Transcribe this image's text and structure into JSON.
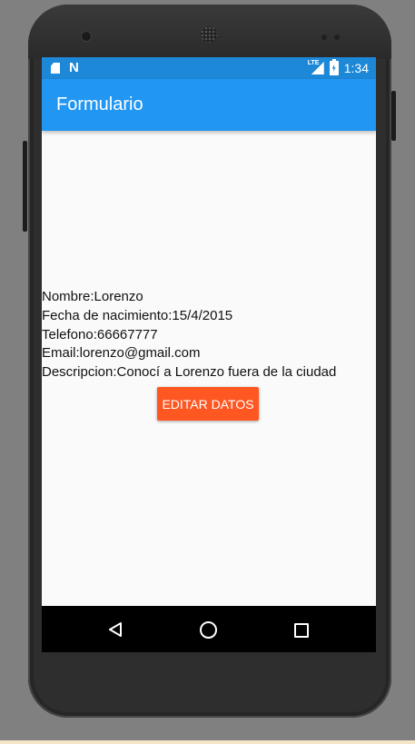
{
  "status_bar": {
    "time": "1:34",
    "network_label": "LTE",
    "icons": [
      "sd-card-icon",
      "n-notification-icon",
      "lte-signal-icon",
      "battery-charging-icon"
    ]
  },
  "app_bar": {
    "title": "Formulario"
  },
  "details": {
    "name": "Nombre:Lorenzo",
    "birth_date": "Fecha de nacimiento:15/4/2015",
    "phone": "Telefono:66667777",
    "email": "Email:lorenzo@gmail.com",
    "description": "Descripcion:Conocí a Lorenzo fuera de la ciudad"
  },
  "actions": {
    "edit_label": "EDITAR DATOS"
  },
  "nav_bar": {
    "buttons": [
      "back-icon",
      "home-icon",
      "recent-apps-icon"
    ]
  },
  "colors": {
    "status_bar": "#1e88d8",
    "app_bar": "#2196f3",
    "button": "#ff5722",
    "background": "#fafafa"
  }
}
